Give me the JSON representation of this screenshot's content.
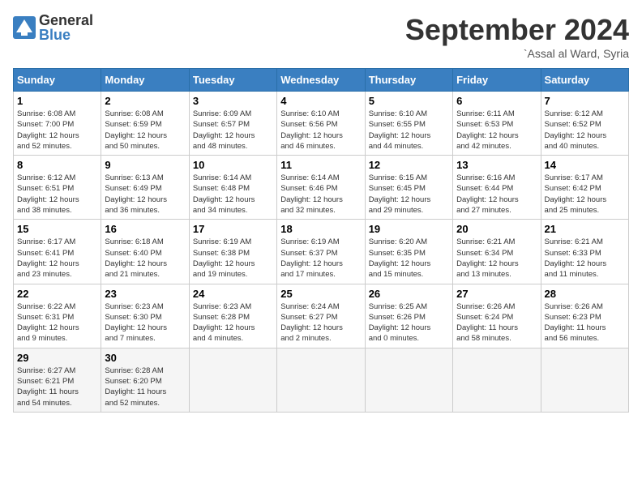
{
  "logo": {
    "general": "General",
    "blue": "Blue"
  },
  "header": {
    "month": "September 2024",
    "location": "`Assal al Ward, Syria"
  },
  "weekdays": [
    "Sunday",
    "Monday",
    "Tuesday",
    "Wednesday",
    "Thursday",
    "Friday",
    "Saturday"
  ],
  "weeks": [
    [
      {
        "day": "1",
        "info": "Sunrise: 6:08 AM\nSunset: 7:00 PM\nDaylight: 12 hours\nand 52 minutes."
      },
      {
        "day": "2",
        "info": "Sunrise: 6:08 AM\nSunset: 6:59 PM\nDaylight: 12 hours\nand 50 minutes."
      },
      {
        "day": "3",
        "info": "Sunrise: 6:09 AM\nSunset: 6:57 PM\nDaylight: 12 hours\nand 48 minutes."
      },
      {
        "day": "4",
        "info": "Sunrise: 6:10 AM\nSunset: 6:56 PM\nDaylight: 12 hours\nand 46 minutes."
      },
      {
        "day": "5",
        "info": "Sunrise: 6:10 AM\nSunset: 6:55 PM\nDaylight: 12 hours\nand 44 minutes."
      },
      {
        "day": "6",
        "info": "Sunrise: 6:11 AM\nSunset: 6:53 PM\nDaylight: 12 hours\nand 42 minutes."
      },
      {
        "day": "7",
        "info": "Sunrise: 6:12 AM\nSunset: 6:52 PM\nDaylight: 12 hours\nand 40 minutes."
      }
    ],
    [
      {
        "day": "8",
        "info": "Sunrise: 6:12 AM\nSunset: 6:51 PM\nDaylight: 12 hours\nand 38 minutes."
      },
      {
        "day": "9",
        "info": "Sunrise: 6:13 AM\nSunset: 6:49 PM\nDaylight: 12 hours\nand 36 minutes."
      },
      {
        "day": "10",
        "info": "Sunrise: 6:14 AM\nSunset: 6:48 PM\nDaylight: 12 hours\nand 34 minutes."
      },
      {
        "day": "11",
        "info": "Sunrise: 6:14 AM\nSunset: 6:46 PM\nDaylight: 12 hours\nand 32 minutes."
      },
      {
        "day": "12",
        "info": "Sunrise: 6:15 AM\nSunset: 6:45 PM\nDaylight: 12 hours\nand 29 minutes."
      },
      {
        "day": "13",
        "info": "Sunrise: 6:16 AM\nSunset: 6:44 PM\nDaylight: 12 hours\nand 27 minutes."
      },
      {
        "day": "14",
        "info": "Sunrise: 6:17 AM\nSunset: 6:42 PM\nDaylight: 12 hours\nand 25 minutes."
      }
    ],
    [
      {
        "day": "15",
        "info": "Sunrise: 6:17 AM\nSunset: 6:41 PM\nDaylight: 12 hours\nand 23 minutes."
      },
      {
        "day": "16",
        "info": "Sunrise: 6:18 AM\nSunset: 6:40 PM\nDaylight: 12 hours\nand 21 minutes."
      },
      {
        "day": "17",
        "info": "Sunrise: 6:19 AM\nSunset: 6:38 PM\nDaylight: 12 hours\nand 19 minutes."
      },
      {
        "day": "18",
        "info": "Sunrise: 6:19 AM\nSunset: 6:37 PM\nDaylight: 12 hours\nand 17 minutes."
      },
      {
        "day": "19",
        "info": "Sunrise: 6:20 AM\nSunset: 6:35 PM\nDaylight: 12 hours\nand 15 minutes."
      },
      {
        "day": "20",
        "info": "Sunrise: 6:21 AM\nSunset: 6:34 PM\nDaylight: 12 hours\nand 13 minutes."
      },
      {
        "day": "21",
        "info": "Sunrise: 6:21 AM\nSunset: 6:33 PM\nDaylight: 12 hours\nand 11 minutes."
      }
    ],
    [
      {
        "day": "22",
        "info": "Sunrise: 6:22 AM\nSunset: 6:31 PM\nDaylight: 12 hours\nand 9 minutes."
      },
      {
        "day": "23",
        "info": "Sunrise: 6:23 AM\nSunset: 6:30 PM\nDaylight: 12 hours\nand 7 minutes."
      },
      {
        "day": "24",
        "info": "Sunrise: 6:23 AM\nSunset: 6:28 PM\nDaylight: 12 hours\nand 4 minutes."
      },
      {
        "day": "25",
        "info": "Sunrise: 6:24 AM\nSunset: 6:27 PM\nDaylight: 12 hours\nand 2 minutes."
      },
      {
        "day": "26",
        "info": "Sunrise: 6:25 AM\nSunset: 6:26 PM\nDaylight: 12 hours\nand 0 minutes."
      },
      {
        "day": "27",
        "info": "Sunrise: 6:26 AM\nSunset: 6:24 PM\nDaylight: 11 hours\nand 58 minutes."
      },
      {
        "day": "28",
        "info": "Sunrise: 6:26 AM\nSunset: 6:23 PM\nDaylight: 11 hours\nand 56 minutes."
      }
    ],
    [
      {
        "day": "29",
        "info": "Sunrise: 6:27 AM\nSunset: 6:21 PM\nDaylight: 11 hours\nand 54 minutes."
      },
      {
        "day": "30",
        "info": "Sunrise: 6:28 AM\nSunset: 6:20 PM\nDaylight: 11 hours\nand 52 minutes."
      },
      {
        "day": "",
        "info": ""
      },
      {
        "day": "",
        "info": ""
      },
      {
        "day": "",
        "info": ""
      },
      {
        "day": "",
        "info": ""
      },
      {
        "day": "",
        "info": ""
      }
    ]
  ]
}
